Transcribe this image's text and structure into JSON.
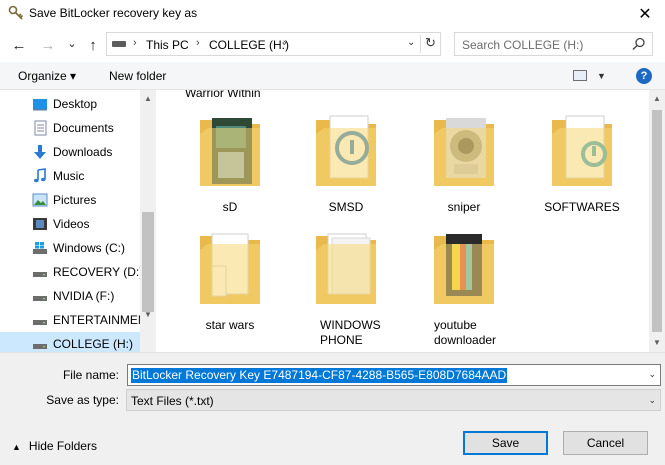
{
  "window": {
    "title": "Save BitLocker recovery key as",
    "close_glyph": "✕"
  },
  "nav": {
    "back_glyph": "←",
    "forward_glyph": "→",
    "recent_glyph": "⌄",
    "up_glyph": "↑"
  },
  "address": {
    "crumbs": [
      "This PC",
      "COLLEGE (H:)"
    ],
    "separator": "›",
    "dropdown_glyph": "⌄",
    "refresh_glyph": "↻"
  },
  "search": {
    "placeholder": "Search COLLEGE (H:)"
  },
  "toolbar": {
    "organize_label": "Organize ▾",
    "new_folder_label": "New folder",
    "view_dropdown_glyph": "▼",
    "help_label": "?"
  },
  "sidebar": {
    "items": [
      {
        "label": "Desktop",
        "icon": "desktop-icon"
      },
      {
        "label": "Documents",
        "icon": "documents-icon"
      },
      {
        "label": "Downloads",
        "icon": "downloads-icon"
      },
      {
        "label": "Music",
        "icon": "music-icon"
      },
      {
        "label": "Pictures",
        "icon": "pictures-icon"
      },
      {
        "label": "Videos",
        "icon": "videos-icon"
      },
      {
        "label": "Windows (C:)",
        "icon": "windows-drive-icon"
      },
      {
        "label": "RECOVERY (D:)",
        "icon": "drive-icon"
      },
      {
        "label": "NVIDIA (F:)",
        "icon": "drive-icon"
      },
      {
        "label": "ENTERTAINMEN",
        "icon": "drive-icon"
      },
      {
        "label": "COLLEGE (H:)",
        "icon": "drive-icon",
        "selected": true
      }
    ],
    "scroll_up_glyph": "▲",
    "scroll_down_glyph": "▼"
  },
  "content": {
    "partial_label": "Warrior Within",
    "folders": [
      {
        "name": "sD",
        "icon": "folder-icon"
      },
      {
        "name": "SMSD",
        "icon": "folder-icon"
      },
      {
        "name": "sniper",
        "icon": "folder-icon"
      },
      {
        "name": "SOFTWARES",
        "icon": "folder-icon"
      },
      {
        "name": "star wars",
        "icon": "folder-icon"
      },
      {
        "name": "WINDOWS PHONE",
        "icon": "folder-icon"
      },
      {
        "name": "youtube downloader",
        "icon": "folder-icon"
      }
    ],
    "scroll_up_glyph": "▲",
    "scroll_down_glyph": "▼"
  },
  "form": {
    "file_name_label": "File name:",
    "file_name_value": "BitLocker Recovery Key E7487194-CF87-4288-B565-E808D7684AAD",
    "save_as_type_label": "Save as type:",
    "save_as_type_value": "Text Files (*.txt)",
    "dropdown_glyph": "⌄"
  },
  "footer": {
    "hide_folders_label": "Hide Folders",
    "hide_folders_glyph": "▲",
    "save_label": "Save",
    "cancel_label": "Cancel"
  },
  "colors": {
    "accent": "#0078d7",
    "folder": "#f8d775",
    "selected_nav": "#cce8ff"
  }
}
